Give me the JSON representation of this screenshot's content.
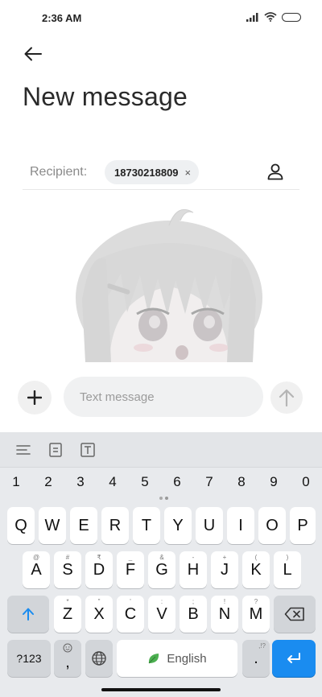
{
  "status_bar": {
    "time": "2:36 AM",
    "icons": [
      "signal-icon",
      "wifi-icon",
      "battery-icon"
    ]
  },
  "header": {
    "back_icon": "back-arrow-icon",
    "title": "New message"
  },
  "recipient": {
    "label": "Recipient:",
    "chip_number": "18730218809",
    "chip_close": "×",
    "contact_icon": "contact-icon"
  },
  "compose": {
    "add_icon": "plus-icon",
    "placeholder": "Text message",
    "value": "",
    "send_icon": "send-arrow-icon"
  },
  "keyboard": {
    "toolbar_icons": [
      "menu-lines-icon",
      "clipboard-icon",
      "text-edit-icon"
    ],
    "number_row": [
      "1",
      "2",
      "3",
      "4",
      "5",
      "6",
      "7",
      "8",
      "9",
      "0"
    ],
    "row1": [
      "Q",
      "W",
      "E",
      "R",
      "T",
      "Y",
      "U",
      "I",
      "O",
      "P"
    ],
    "row2": [
      "A",
      "S",
      "D",
      "F",
      "G",
      "H",
      "J",
      "K",
      "L"
    ],
    "row2_hints": [
      "@",
      "#",
      "₹",
      "_",
      "%",
      "&",
      "-",
      "+",
      "(",
      ")"
    ],
    "row3": [
      "Z",
      "X",
      "C",
      "V",
      "B",
      "N",
      "M"
    ],
    "row3_hints": [
      "*",
      "\"",
      "'",
      ":",
      ";",
      "!",
      "?"
    ],
    "symbols_label": "?123",
    "comma_label": ",",
    "space_label": "English",
    "period_label": ".",
    "period_hint": ",!?",
    "accent_color": "#1a8cf0"
  }
}
